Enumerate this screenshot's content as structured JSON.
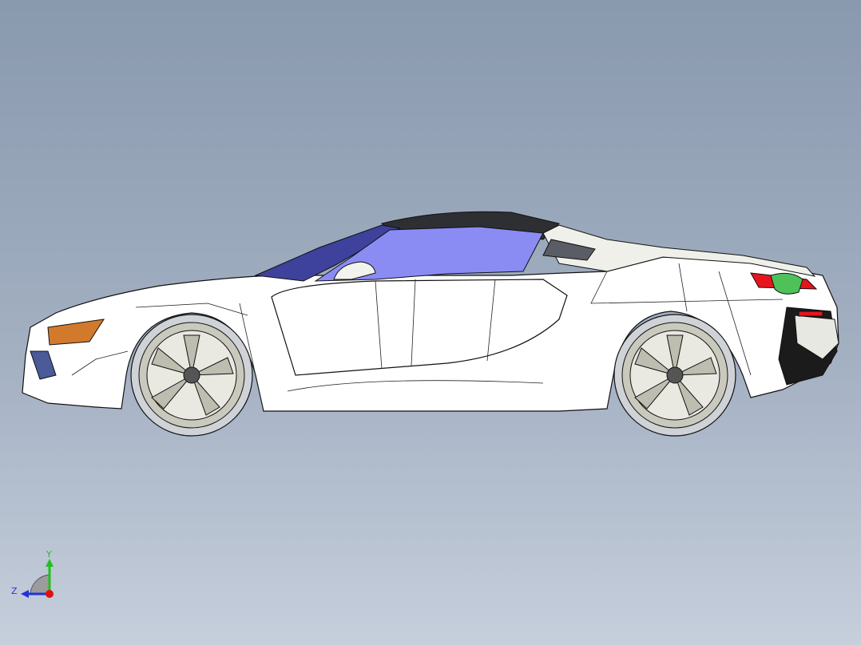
{
  "viewport": {
    "background_top": "#8999ae",
    "background_bottom": "#c6cfdc",
    "model_kind": "car-side-view"
  },
  "model_colors": {
    "body": "#ffffff",
    "edges": "#111111",
    "glass": "#8a8cf4",
    "glass_dark": "#3e429c",
    "roof": "#2e2f33",
    "headlight": "#d27a2c",
    "taillight_red": "#e8141c",
    "green_accent": "#4fc159",
    "wheel_metal": "#c9c9bd",
    "tyre": "#cfd3d7"
  },
  "triad": {
    "x_label": "",
    "y_label": "Y",
    "z_label": "Z",
    "y_color": "#1fbf1f",
    "z_color": "#2233dd",
    "x_color": "#e01010"
  }
}
